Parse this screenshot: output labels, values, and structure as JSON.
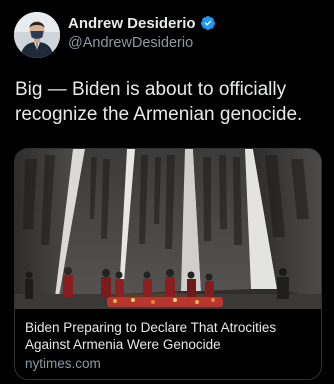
{
  "tweet": {
    "author": {
      "display_name": "Andrew Desiderio",
      "handle": "@AndrewDesiderio",
      "verified_icon": "verified-badge-icon",
      "avatar": "avatar-photo"
    },
    "text": "Big — Biden is about to officially recognize the Armenian genocide.",
    "card": {
      "image": "genocide-memorial-photo",
      "title": "Biden Preparing to Declare That Atrocities Against Armenia Were Genocide",
      "domain": "nytimes.com"
    }
  },
  "colors": {
    "background": "#000000",
    "primary_text": "#e7e9ea",
    "secondary_text": "#8b98a5",
    "border": "#2f3336",
    "verified_blue": "#1d9bf0"
  }
}
